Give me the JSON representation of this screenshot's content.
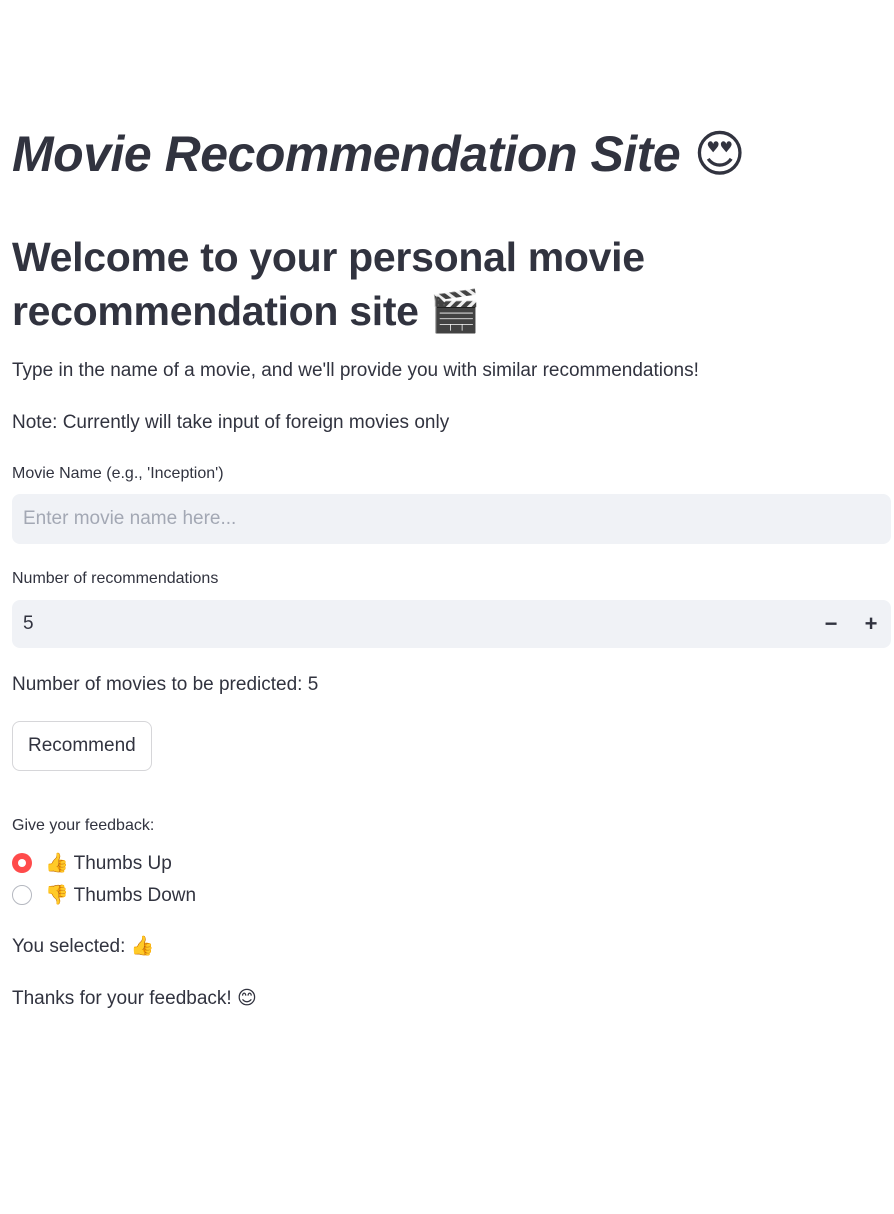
{
  "title": {
    "text": "Movie Recommendation Site",
    "emoji": "😍"
  },
  "welcome": {
    "text": "Welcome to your personal movie recommendation site",
    "emoji": "🎬"
  },
  "intro": "Type in the name of a movie, and we'll provide you with similar recommendations!",
  "note": "Note: Currently will take input of foreign movies only",
  "movie_input": {
    "label": "Movie Name (e.g., 'Inception')",
    "value": "",
    "placeholder": "Enter movie name here..."
  },
  "num_recs": {
    "label": "Number of recommendations",
    "value": "5",
    "minus": "−",
    "plus": "+"
  },
  "predicted_text": "Number of movies to be predicted: 5",
  "recommend_button": "Recommend",
  "feedback": {
    "label": "Give your feedback:",
    "options": [
      {
        "icon": "👍",
        "label": "Thumbs Up",
        "selected": true
      },
      {
        "icon": "👎",
        "label": "Thumbs Down",
        "selected": false
      }
    ],
    "selected_prefix": "You selected:",
    "selected_icon": "👍",
    "thanks": "Thanks for your feedback!",
    "thanks_emoji": "😊"
  },
  "colors": {
    "accent": "#ff4b4b",
    "text": "#31333f",
    "input_bg": "#f0f2f6"
  }
}
